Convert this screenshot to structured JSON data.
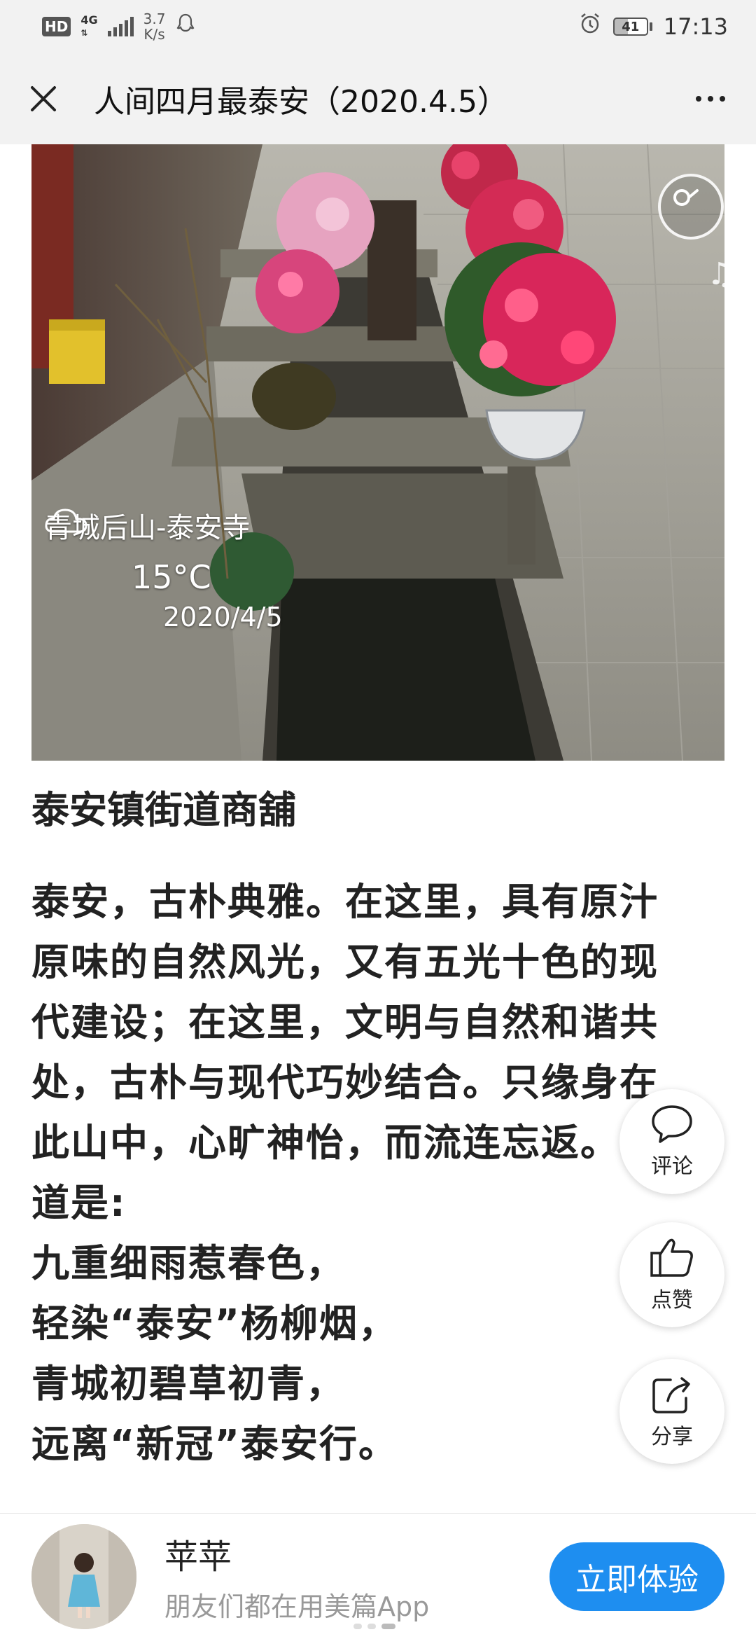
{
  "status_bar": {
    "hd": "HD",
    "network": "4G",
    "speed_value": "3.7",
    "speed_unit": "K/s",
    "battery": "41",
    "time": "17:13"
  },
  "header": {
    "title": "人间四月最泰安（2020.4.5）"
  },
  "photo": {
    "place": "青城后山-泰安寺",
    "temperature": "15°C",
    "date": "2020/4/5",
    "weather_icon": "cloud-icon"
  },
  "article": {
    "section_title": "泰安镇街道商舖",
    "lines": [
      "泰安，古朴典雅。在这里，具有原汁",
      "原味的自然风光，又有五光十色的现",
      "代建设；在这里，文明与自然和谐共",
      "处，古朴与现代巧妙结合。只缘身在",
      "此山中，心旷神怡，而流连忘返。有",
      "道是:",
      "九重细雨惹春色，",
      "轻染“泰安”杨柳烟，",
      "青城初碧草初青，",
      "远离“新冠”泰安行。"
    ]
  },
  "actions": {
    "comment": "评论",
    "like": "点赞",
    "share": "分享"
  },
  "footer": {
    "user_name": "苹苹",
    "subtitle": "朋友们都在用美篇App",
    "cta": "立即体验"
  },
  "colors": {
    "accent": "#1e8ef0",
    "bar_bg": "#f2f2f2"
  }
}
